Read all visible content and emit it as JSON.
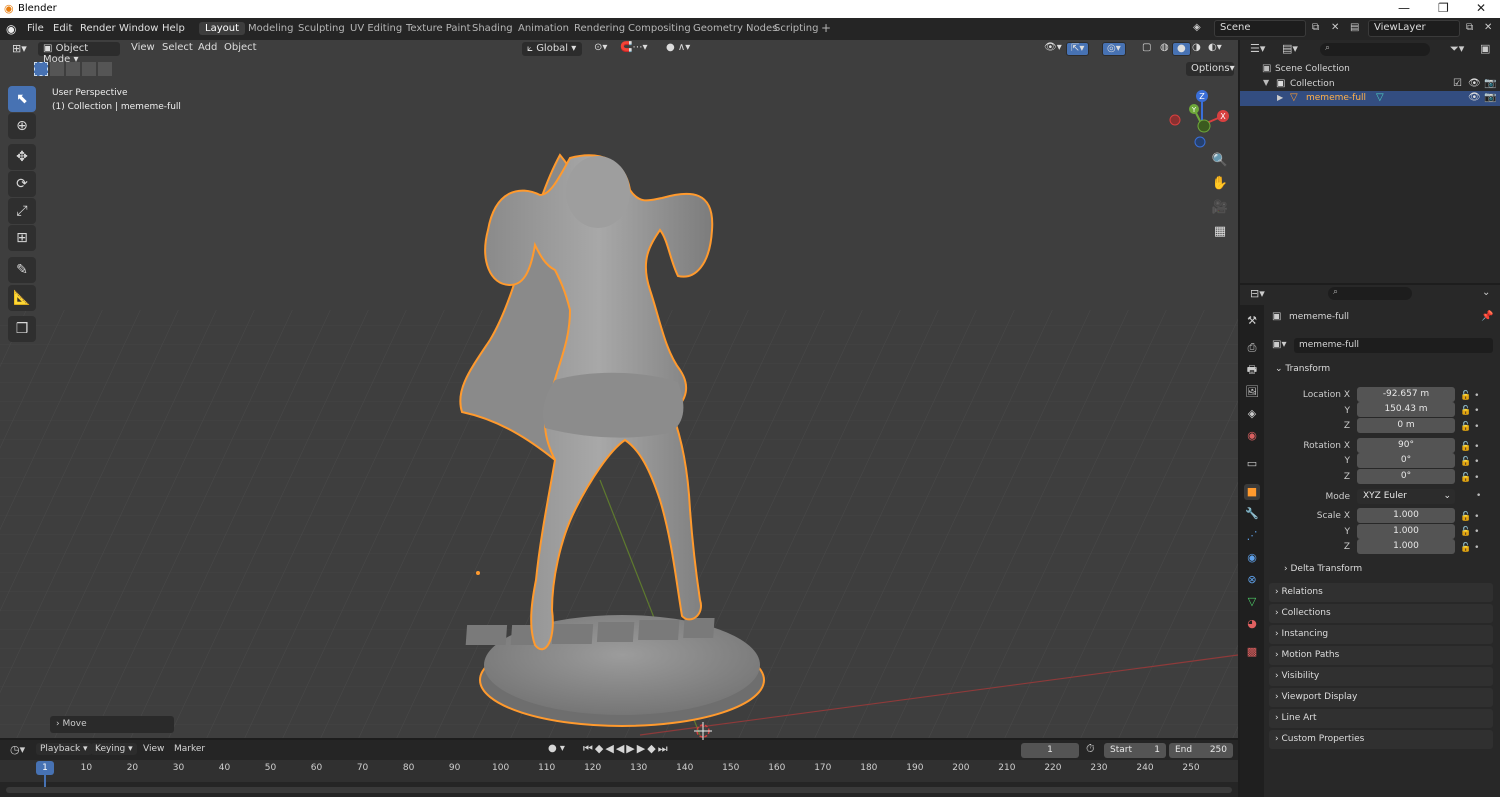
{
  "window": {
    "title": "Blender",
    "minimize": "—",
    "maximize": "❐",
    "close": "✕"
  },
  "menu": [
    "File",
    "Edit",
    "Render",
    "Window",
    "Help"
  ],
  "workspaces": [
    "Layout",
    "Modeling",
    "Sculpting",
    "UV Editing",
    "Texture Paint",
    "Shading",
    "Animation",
    "Rendering",
    "Compositing",
    "Geometry Nodes",
    "Scripting"
  ],
  "active_workspace": "Layout",
  "add_workspace": "+",
  "scene": {
    "name": "Scene",
    "view_layer": "ViewLayer"
  },
  "viewport_header": {
    "mode": "Object Mode",
    "menus": [
      "View",
      "Select",
      "Add",
      "Object"
    ],
    "orientation": "Global",
    "options": "Options"
  },
  "viewport_overlay": {
    "line1": "User Perspective",
    "line2": "(1) Collection | mememe-full"
  },
  "operator_panel": {
    "label": "Move"
  },
  "gizmo": {
    "z": "Z",
    "y": "Y",
    "x": "X"
  },
  "model": {
    "base_text": "MEMEME"
  },
  "outliner": {
    "items": [
      {
        "label": "Scene Collection"
      },
      {
        "label": "Collection"
      },
      {
        "label": "mememe-full"
      }
    ]
  },
  "properties": {
    "object_name": "mememe-full",
    "object_field": "mememe-full",
    "transform_label": "Transform",
    "location": {
      "label": "Location X",
      "x": "-92.657 m",
      "y": "150.43 m",
      "z": "0 m"
    },
    "rotation": {
      "label": "Rotation X",
      "x": "90°",
      "y": "0°",
      "z": "0°"
    },
    "mode_label": "Mode",
    "mode_value": "XYZ Euler",
    "scale": {
      "label": "Scale X",
      "x": "1.000",
      "y": "1.000",
      "z": "1.000"
    },
    "axis_y": "Y",
    "axis_z": "Z",
    "delta": "Delta Transform",
    "panels": [
      "Relations",
      "Collections",
      "Instancing",
      "Motion Paths",
      "Visibility",
      "Viewport Display",
      "Line Art",
      "Custom Properties"
    ]
  },
  "timeline": {
    "menus": [
      "Playback",
      "Keying",
      "View",
      "Marker"
    ],
    "current_frame": "1",
    "start_label": "Start",
    "start": "1",
    "end_label": "End",
    "end": "250",
    "ticks": [
      "1",
      "10",
      "20",
      "30",
      "40",
      "50",
      "60",
      "70",
      "80",
      "90",
      "100",
      "110",
      "120",
      "130",
      "140",
      "150",
      "160",
      "170",
      "180",
      "190",
      "200",
      "210",
      "220",
      "230",
      "240",
      "250"
    ]
  },
  "colors": {
    "accent": "#4772b3",
    "selection": "#ff9a2e",
    "viewport_bg": "#3e3e3e",
    "panel_bg": "#282828"
  }
}
